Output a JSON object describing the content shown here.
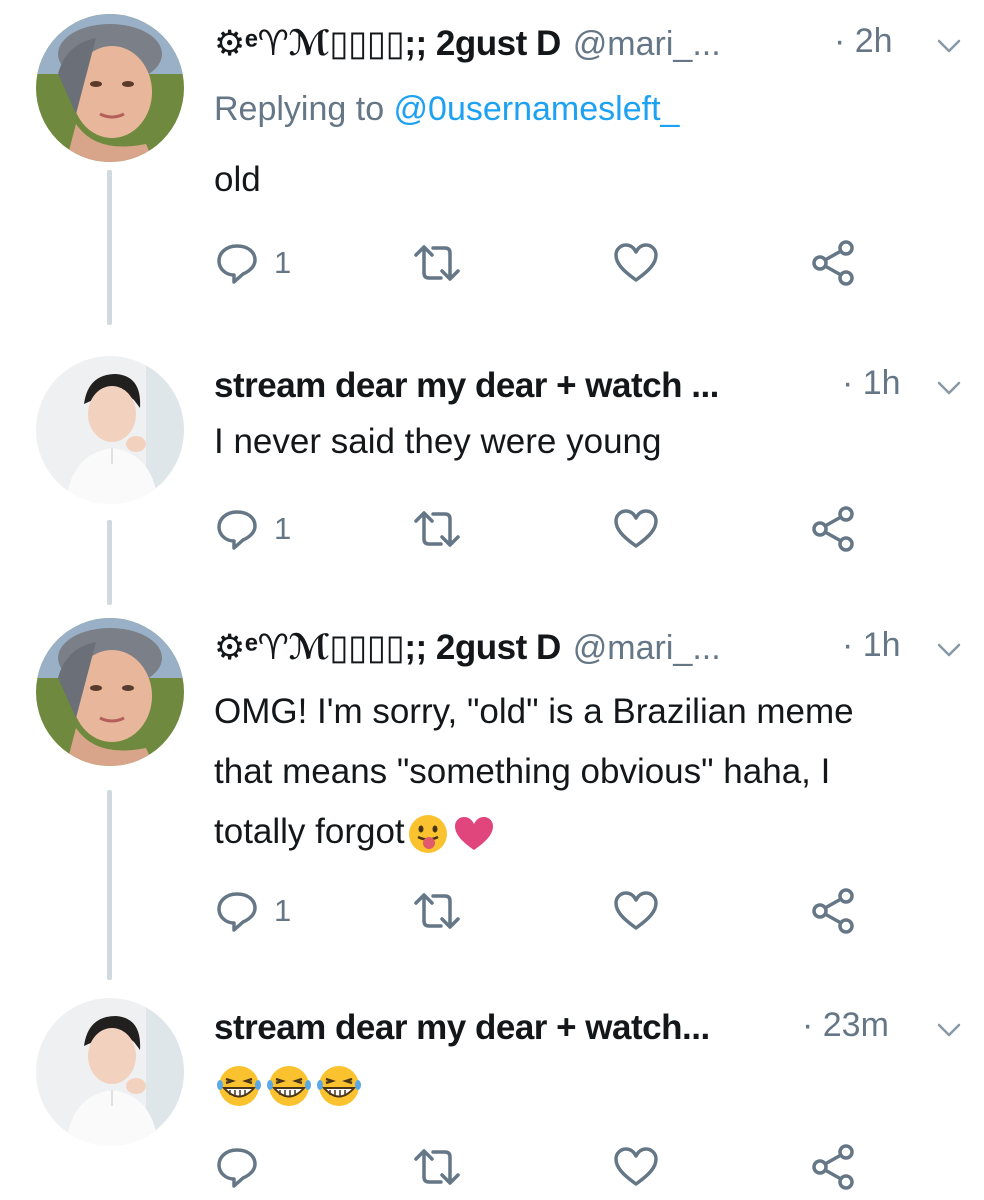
{
  "tweets": [
    {
      "name": "⚙ᵉ♈ℳ▯▯▯▯;; 2gust D",
      "handle": "@mari_...",
      "time": "· 2h",
      "replying_prefix": "Replying to ",
      "replying_handle": "@0usernamesleft_",
      "text": "old",
      "reply_count": "1",
      "avatar": "woman-avatar"
    },
    {
      "name": "stream dear my dear + watch ...",
      "handle": "",
      "time": "· 1h",
      "text": "I never said they were young",
      "reply_count": "1",
      "avatar": "man-avatar"
    },
    {
      "name": "⚙ᵉ♈ℳ▯▯▯▯;; 2gust D",
      "handle": "@mari_...",
      "time": "· 1h",
      "text_lines": [
        "OMG! I'm sorry, \"old\" is a Brazilian meme",
        "that means \"something obvious\" haha, I",
        "totally forgot"
      ],
      "reply_count": "1",
      "avatar": "woman-avatar"
    },
    {
      "name": "stream dear my dear + watch...",
      "handle": "",
      "time": "· 23m",
      "text": "",
      "reply_count": "",
      "avatar": "man-avatar"
    }
  ],
  "icons": {
    "reply": "reply-icon",
    "retweet": "retweet-icon",
    "like": "heart-icon",
    "share": "share-icon",
    "more": "chevron-down-icon"
  },
  "emojis": {
    "tweet3": [
      "tongue-out-emoji",
      "pink-heart-emoji"
    ],
    "tweet4": [
      "laughing-emoji",
      "laughing-emoji",
      "laughing-emoji"
    ]
  },
  "colors": {
    "text": "#14171a",
    "secondary": "#657786",
    "link": "#1da1f2",
    "thread_line": "#cfd9de"
  }
}
